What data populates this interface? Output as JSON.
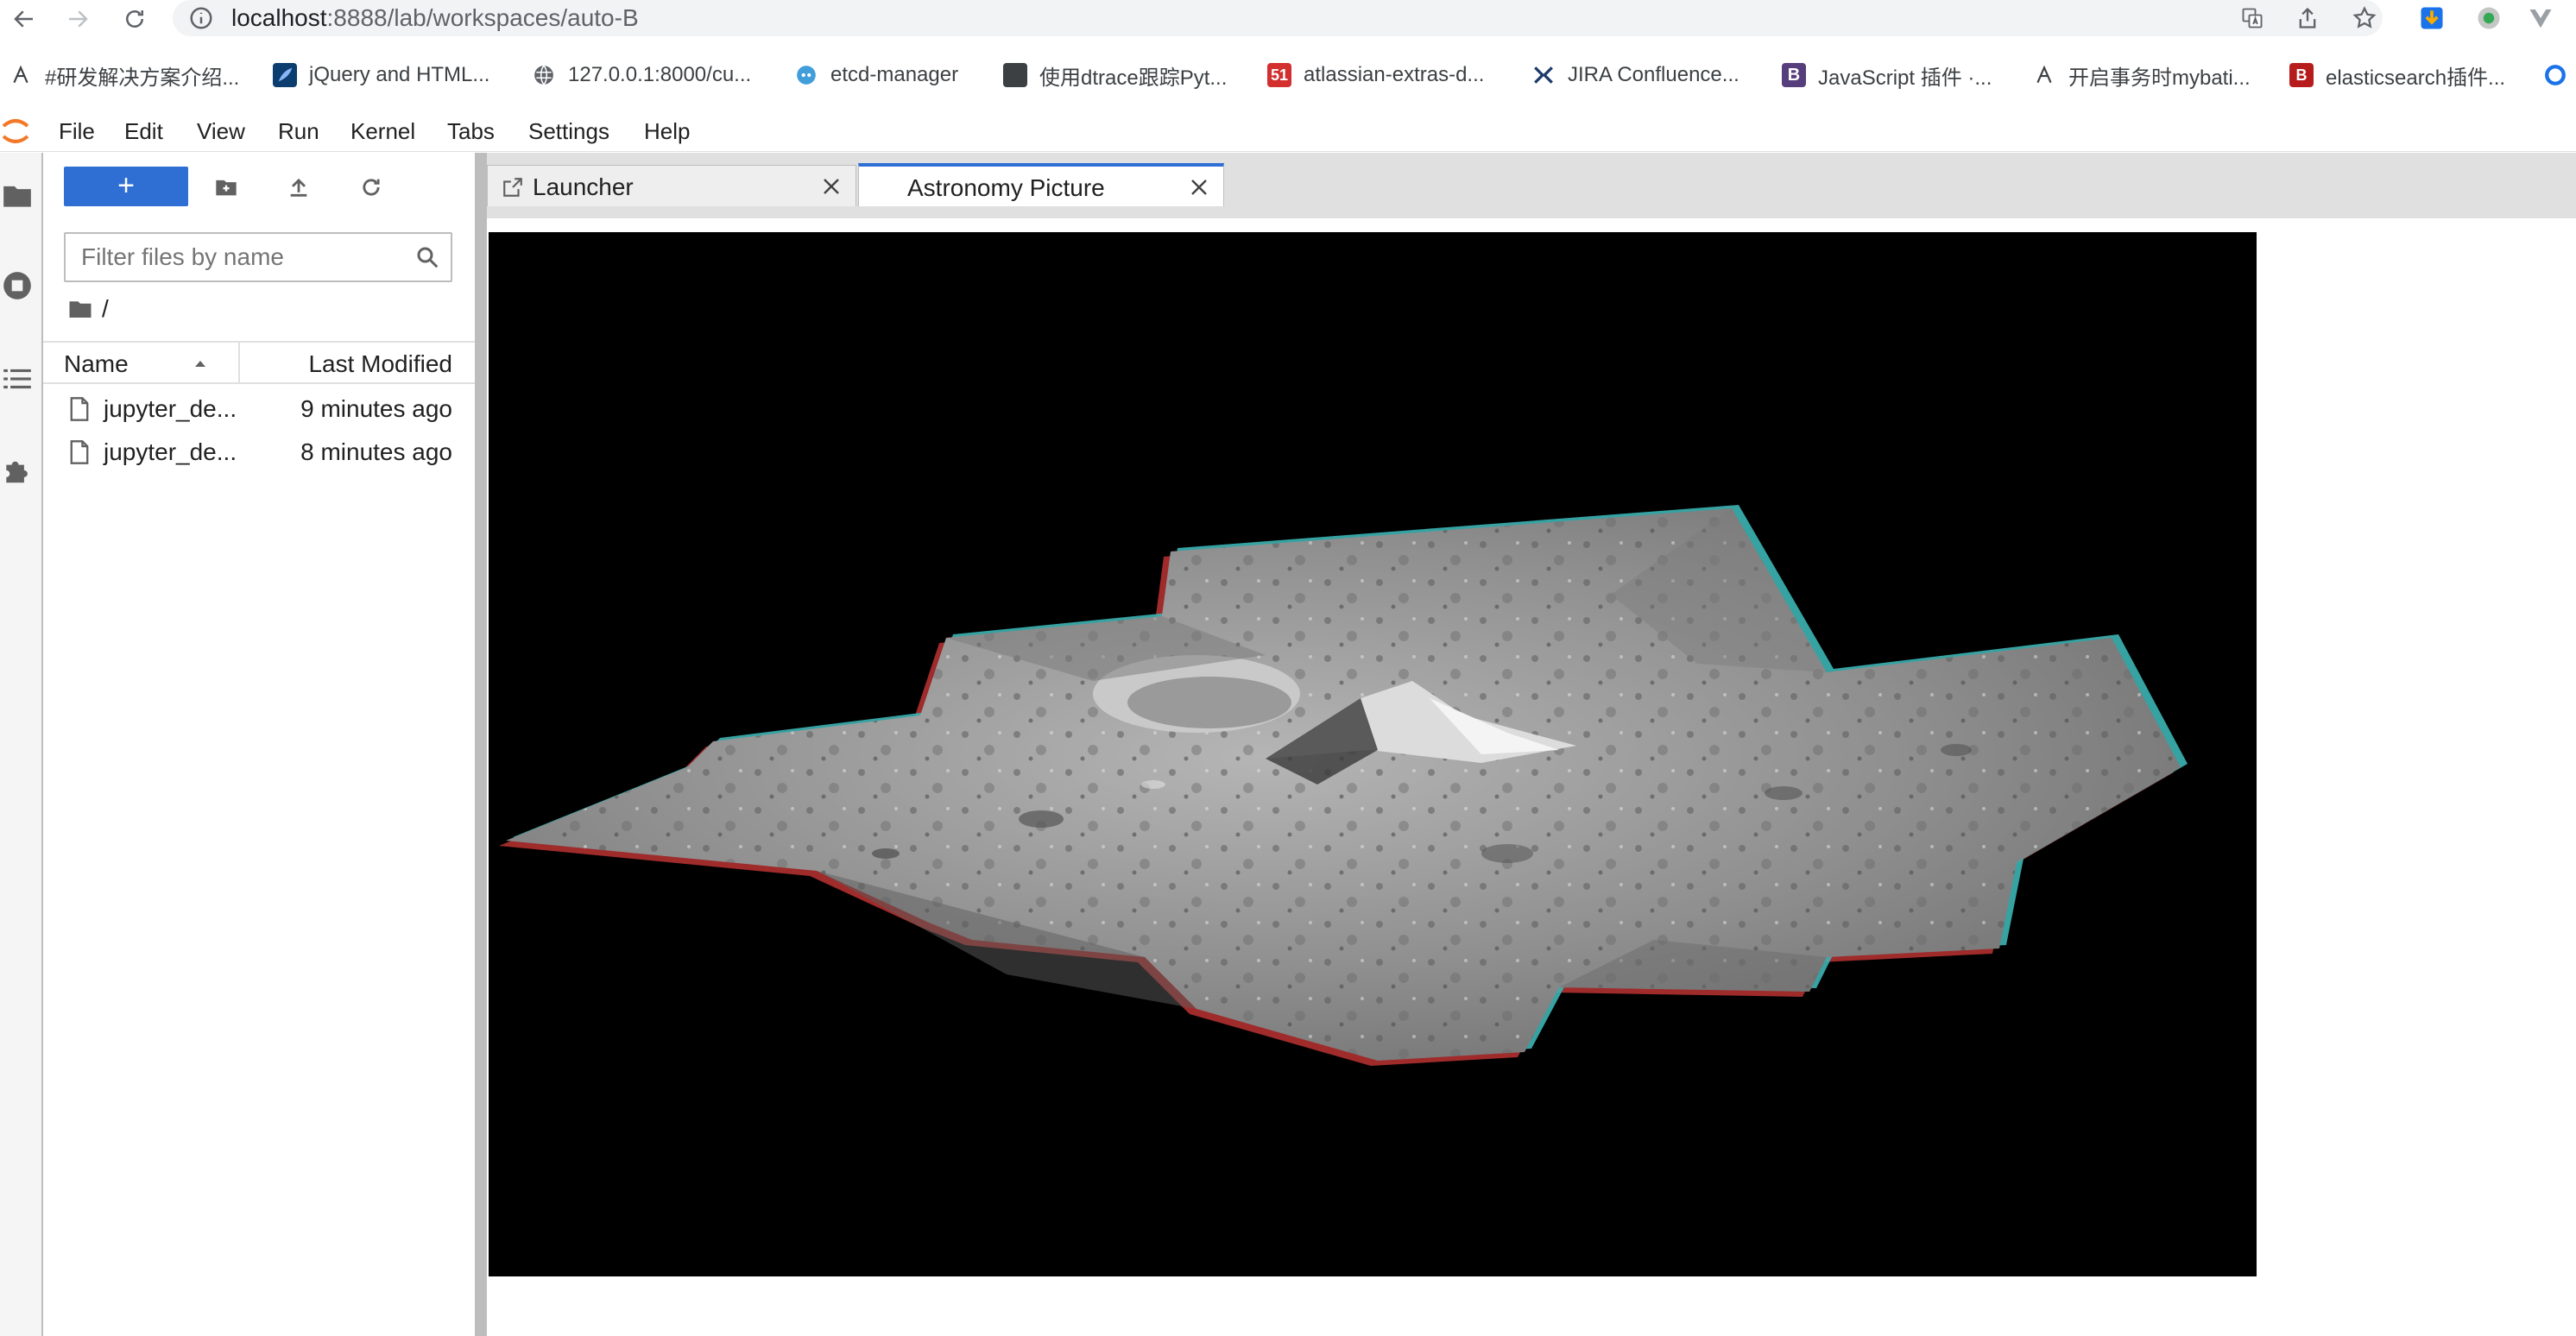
{
  "browser": {
    "url_host": "localhost",
    "url_path": ":8888/lab/workspaces/auto-B",
    "bookmarks": [
      {
        "label": "#研发解决方案介绍...",
        "icon": "dev-ops-icon"
      },
      {
        "label": "jQuery and HTML...",
        "icon": "feather-icon"
      },
      {
        "label": "127.0.0.1:8000/cu...",
        "icon": "globe-icon"
      },
      {
        "label": "etcd-manager",
        "icon": "etcd-icon"
      },
      {
        "label": "使用dtrace跟踪Pyt...",
        "icon": "page-icon"
      },
      {
        "label": "atlassian-extras-d...",
        "icon": "51cto-icon"
      },
      {
        "label": "JIRA Confluence...",
        "icon": "jira-icon"
      },
      {
        "label": "JavaScript 插件 ·...",
        "icon": "bootstrap-icon"
      },
      {
        "label": "开启事务时mybati...",
        "icon": "dev-ops-icon"
      },
      {
        "label": "elasticsearch插件...",
        "icon": "elastic-icon"
      }
    ]
  },
  "menubar": {
    "items": [
      "File",
      "Edit",
      "View",
      "Run",
      "Kernel",
      "Tabs",
      "Settings",
      "Help"
    ]
  },
  "filebrowser": {
    "new_label": "+",
    "filter_placeholder": "Filter files by name",
    "breadcrumb": "/",
    "col_name": "Name",
    "col_modified": "Last Modified",
    "files": [
      {
        "name": "jupyter_de...",
        "modified": "9 minutes ago"
      },
      {
        "name": "jupyter_de...",
        "modified": "8 minutes ago"
      }
    ]
  },
  "tabs": [
    {
      "label": "Launcher",
      "active": false
    },
    {
      "label": "Astronomy Picture",
      "active": true
    }
  ],
  "colors": {
    "accent": "#2f6fd4",
    "image_background": "#000000"
  }
}
